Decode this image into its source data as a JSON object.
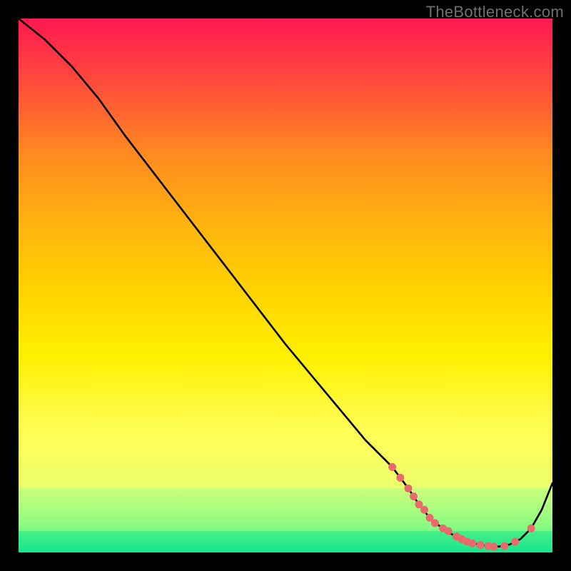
{
  "watermark": "TheBottleneck.com",
  "chart_data": {
    "type": "line",
    "title": "",
    "xlabel": "",
    "ylabel": "",
    "xlim": [
      0,
      100
    ],
    "ylim": [
      0,
      100
    ],
    "series": [
      {
        "name": "bottleneck-curve",
        "x": [
          0,
          5,
          10,
          15,
          20,
          25,
          30,
          35,
          40,
          45,
          50,
          55,
          60,
          65,
          70,
          73,
          75,
          77,
          80,
          83,
          85,
          88,
          90,
          92,
          94,
          96,
          98,
          100
        ],
        "y": [
          100,
          96,
          91,
          85,
          78,
          71.5,
          65,
          58.5,
          52,
          45.5,
          39,
          33,
          27,
          21,
          16,
          12,
          9,
          6.5,
          4,
          2.5,
          1.7,
          1.2,
          1.1,
          1.5,
          2.5,
          4.5,
          8,
          13
        ]
      }
    ],
    "scatter_points": {
      "name": "sample-points",
      "color": "#e86a6a",
      "x": [
        70,
        71.5,
        73,
        74,
        75,
        76,
        77,
        78,
        79.5,
        80.5,
        82,
        83,
        84,
        85,
        86.5,
        88,
        89,
        91,
        93,
        96
      ],
      "y": [
        16,
        14,
        12,
        10.5,
        9,
        8,
        6.5,
        5.5,
        4.5,
        4,
        3,
        2.5,
        2,
        1.7,
        1.4,
        1.2,
        1.1,
        1.2,
        2,
        4.5
      ]
    },
    "background_bands": [
      {
        "top": 0,
        "height": 76,
        "gradient": [
          "#ff1850",
          "#ff4e3a",
          "#ff8a20",
          "#ffb210",
          "#ffd200",
          "#fff000",
          "#fffd50"
        ]
      },
      {
        "top": 76,
        "height": 12,
        "gradient": [
          "#fffd50",
          "#f9ff60",
          "#eaff6a"
        ]
      },
      {
        "top": 88,
        "height": 8,
        "gradient": [
          "#caff7a",
          "#a9fd7f",
          "#7ef983"
        ]
      },
      {
        "top": 96,
        "height": 4,
        "gradient": [
          "#48ef87",
          "#15e68e"
        ]
      }
    ]
  }
}
